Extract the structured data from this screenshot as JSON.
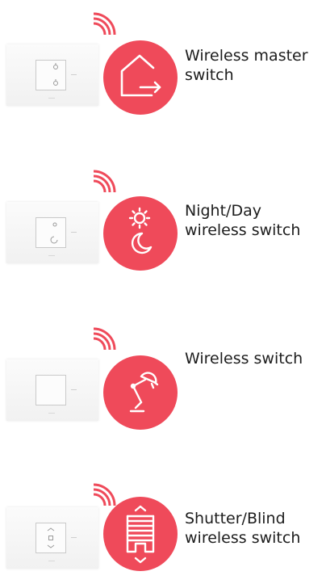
{
  "items": [
    {
      "label": "Wireless master\nswitch",
      "icon": "house-exit-icon"
    },
    {
      "label": "Night/Day\nwireless switch",
      "icon": "sun-moon-icon"
    },
    {
      "label": "Wireless switch",
      "icon": "desk-lamp-icon"
    },
    {
      "label": "Shutter/Blind\nwireless switch",
      "icon": "shutter-icon"
    }
  ],
  "colors": {
    "accent": "#ef4a5a"
  }
}
